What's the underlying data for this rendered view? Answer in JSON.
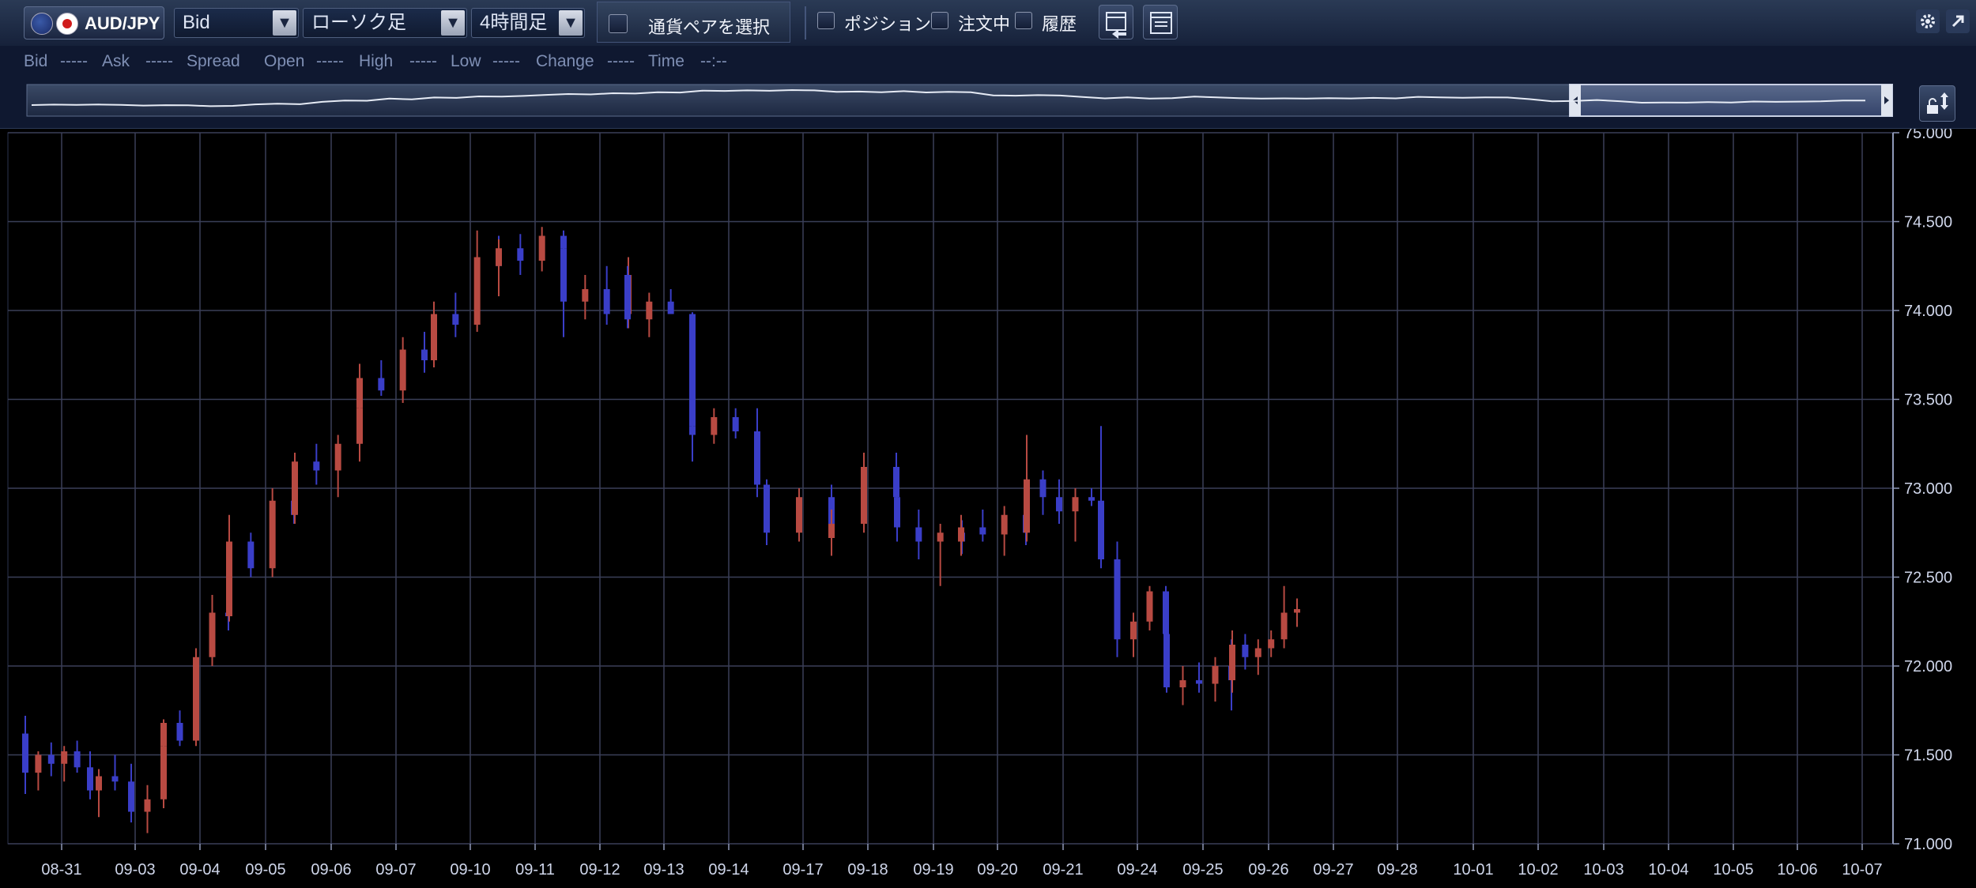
{
  "toolbar": {
    "pair": "AUD/JPY",
    "price_type": "Bid",
    "chart_type": "ローソク足",
    "timeframe": "4時間足",
    "select_pair_label": "通貨ペアを選択",
    "position_label": "ポジション",
    "orders_label": "注文中",
    "history_label": "履歴",
    "dropdown_arrow": "▼"
  },
  "info": {
    "bid_label": "Bid",
    "bid_value": "-----",
    "ask_label": "Ask",
    "ask_value": "-----",
    "spread_label": "Spread",
    "open_label": "Open",
    "open_value": "-----",
    "high_label": "High",
    "high_value": "-----",
    "low_label": "Low",
    "low_value": "-----",
    "change_label": "Change",
    "change_value": "-----",
    "time_label": "Time",
    "time_value": "--:--"
  },
  "colors": {
    "up": "#b84a42",
    "down": "#3a3ec8",
    "grid": "#3a3f58",
    "background": "#000000",
    "axis_text": "#cfd6ea"
  },
  "chart_data": {
    "type": "candlestick",
    "title": "",
    "xlabel": "",
    "ylabel": "",
    "ylim": [
      71.0,
      75.0
    ],
    "y_ticks": [
      "75.000",
      "74.500",
      "74.000",
      "73.500",
      "73.000",
      "72.500",
      "72.000",
      "71.500",
      "71.000"
    ],
    "x_labels": [
      "08-31",
      "09-03",
      "09-04",
      "09-05",
      "09-06",
      "09-07",
      "09-10",
      "09-11",
      "09-12",
      "09-13",
      "09-14",
      "09-17",
      "09-18",
      "09-19",
      "09-20",
      "09-21",
      "09-24",
      "09-25",
      "09-26",
      "09-27",
      "09-28",
      "10-01",
      "10-02",
      "10-03",
      "10-04",
      "10-05",
      "10-06",
      "10-07"
    ],
    "grid": true,
    "series": [
      {
        "values": [
          [
            71.62,
            71.72,
            71.28,
            71.4
          ],
          [
            71.4,
            71.52,
            71.3,
            71.5
          ],
          [
            71.5,
            71.57,
            71.38,
            71.45
          ],
          [
            71.45,
            71.55,
            71.35,
            71.52
          ],
          [
            71.52,
            71.58,
            71.4,
            71.43
          ],
          [
            71.43,
            71.52,
            71.25,
            71.3
          ]
        ]
      },
      {
        "values": [
          [
            71.3,
            71.42,
            71.15,
            71.38
          ],
          [
            71.38,
            71.5,
            71.3,
            71.35
          ],
          [
            71.35,
            71.45,
            71.12,
            71.18
          ],
          [
            71.18,
            71.33,
            71.06,
            71.25
          ],
          [
            71.25,
            71.62,
            71.2,
            71.55
          ]
        ]
      },
      {
        "values": [
          [
            71.55,
            71.7,
            71.5,
            71.68
          ],
          [
            71.68,
            71.75,
            71.55,
            71.58
          ],
          [
            71.58,
            72.1,
            71.55,
            72.05
          ],
          [
            72.05,
            72.4,
            72.0,
            72.3
          ],
          [
            72.3,
            72.48,
            72.2,
            72.28
          ]
        ]
      },
      {
        "values": [
          [
            72.28,
            72.85,
            72.25,
            72.7
          ],
          [
            72.7,
            72.75,
            72.5,
            72.55
          ],
          [
            72.55,
            73.0,
            72.5,
            72.93
          ],
          [
            72.93,
            73.05,
            72.8,
            72.85
          ]
        ]
      },
      {
        "values": [
          [
            72.85,
            73.2,
            72.8,
            73.15
          ],
          [
            73.15,
            73.25,
            73.02,
            73.1
          ],
          [
            73.1,
            73.3,
            72.95,
            73.25
          ],
          [
            73.25,
            73.5,
            73.15,
            73.45
          ]
        ]
      },
      {
        "values": [
          [
            73.45,
            73.7,
            73.4,
            73.62
          ],
          [
            73.62,
            73.72,
            73.52,
            73.55
          ],
          [
            73.55,
            73.85,
            73.48,
            73.78
          ],
          [
            73.78,
            73.88,
            73.65,
            73.72
          ]
        ]
      },
      {
        "values": [
          [
            73.72,
            74.05,
            73.68,
            73.98
          ],
          [
            73.98,
            74.1,
            73.85,
            73.92
          ],
          [
            73.92,
            74.45,
            73.88,
            74.3
          ],
          [
            74.3,
            74.42,
            74.2,
            74.25
          ]
        ]
      },
      {
        "values": [
          [
            74.25,
            74.4,
            74.08,
            74.35
          ],
          [
            74.35,
            74.43,
            74.2,
            74.28
          ],
          [
            74.28,
            74.47,
            74.22,
            74.42
          ],
          [
            74.42,
            74.45,
            74.25,
            74.35
          ]
        ]
      },
      {
        "values": [
          [
            74.35,
            74.4,
            73.85,
            74.05
          ],
          [
            74.05,
            74.2,
            73.95,
            74.12
          ],
          [
            74.12,
            74.25,
            73.92,
            73.98
          ],
          [
            73.98,
            74.3,
            73.9,
            74.2
          ]
        ]
      },
      {
        "values": [
          [
            74.2,
            74.25,
            73.9,
            73.95
          ],
          [
            73.95,
            74.1,
            73.85,
            74.05
          ],
          [
            74.05,
            74.12,
            73.98,
            73.98
          ],
          [
            73.98,
            73.99,
            73.15,
            73.35
          ]
        ]
      },
      {
        "values": [
          [
            73.35,
            73.48,
            73.18,
            73.3
          ],
          [
            73.3,
            73.45,
            73.25,
            73.4
          ],
          [
            73.4,
            73.45,
            73.28,
            73.32
          ],
          [
            73.32,
            73.45,
            72.95,
            73.02
          ]
        ]
      },
      {
        "values": [
          [
            73.02,
            73.05,
            72.68,
            72.75
          ],
          [
            72.75,
            73.0,
            72.7,
            72.95
          ],
          [
            72.95,
            73.02,
            72.62,
            72.72
          ]
        ]
      },
      {
        "values": [
          [
            72.72,
            72.88,
            72.62,
            72.8
          ],
          [
            72.8,
            73.2,
            72.75,
            73.12
          ],
          [
            73.12,
            73.2,
            72.85,
            72.95
          ]
        ]
      },
      {
        "values": [
          [
            72.95,
            73.0,
            72.7,
            72.78
          ],
          [
            72.78,
            72.88,
            72.6,
            72.7
          ],
          [
            72.7,
            72.8,
            72.45,
            72.75
          ],
          [
            72.75,
            72.82,
            72.63,
            72.7
          ]
        ]
      },
      {
        "values": [
          [
            72.7,
            72.85,
            72.62,
            72.78
          ],
          [
            72.78,
            72.88,
            72.7,
            72.74
          ],
          [
            72.74,
            72.9,
            72.62,
            72.85
          ],
          [
            72.85,
            72.95,
            72.68,
            72.75
          ]
        ]
      },
      {
        "values": [
          [
            72.75,
            73.3,
            72.7,
            73.05
          ],
          [
            73.05,
            73.1,
            72.85,
            72.95
          ],
          [
            72.95,
            73.05,
            72.8,
            72.87
          ],
          [
            72.87,
            73.0,
            72.7,
            72.95
          ],
          [
            72.95,
            73.0,
            72.9,
            72.93
          ]
        ]
      },
      {
        "values": [
          [
            72.93,
            73.35,
            72.55,
            72.6
          ],
          [
            72.6,
            72.7,
            72.05,
            72.15
          ],
          [
            72.15,
            72.3,
            72.05,
            72.25
          ],
          [
            72.25,
            72.45,
            72.2,
            72.42
          ],
          [
            72.42,
            72.45,
            72.15,
            72.18
          ]
        ]
      },
      {
        "values": [
          [
            72.18,
            72.2,
            71.85,
            71.88
          ],
          [
            71.88,
            72.0,
            71.78,
            71.92
          ],
          [
            71.92,
            72.02,
            71.85,
            71.9
          ],
          [
            71.9,
            72.05,
            71.8,
            72.0
          ],
          [
            72.0,
            72.15,
            71.75,
            71.92
          ]
        ]
      },
      {
        "values": [
          [
            71.92,
            72.2,
            71.85,
            72.12
          ],
          [
            72.12,
            72.18,
            71.98,
            72.05
          ],
          [
            72.05,
            72.15,
            71.95,
            72.1
          ],
          [
            72.1,
            72.2,
            72.05,
            72.15
          ],
          [
            72.15,
            72.45,
            72.1,
            72.3
          ],
          [
            72.3,
            72.38,
            72.22,
            72.32
          ]
        ]
      }
    ]
  }
}
